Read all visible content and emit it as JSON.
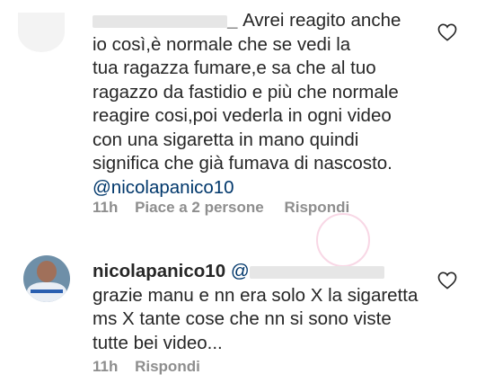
{
  "comments": [
    {
      "username_visible": "_",
      "text_lines": [
        "Avrei reagito anche",
        "io così,è normale che se vedi la",
        "tua ragazza fumare,e sa che al tuo",
        "ragazzo da fastidio e più che normale",
        "reagire cosi,poi vederla in ogni video",
        "con una sigaretta in mano quindi",
        "significa che già fumava di nascosto."
      ],
      "mention": "@nicolapanico10",
      "time": "11h",
      "likes": "Piace a 2 persone",
      "reply": "Rispondi"
    },
    {
      "username": "nicolapanico10",
      "mention": "@",
      "text_lines": [
        "grazie manu e nn era solo X la sigaretta",
        "ms X tante cose  che nn si sono viste",
        "tutte bei video..."
      ],
      "time": "11h",
      "reply": "Rispondi"
    }
  ],
  "icons": [
    "heart-icon",
    "avatar"
  ],
  "colors": {
    "text": "#262626",
    "meta": "#8e8e8e",
    "mention": "#00376b"
  }
}
